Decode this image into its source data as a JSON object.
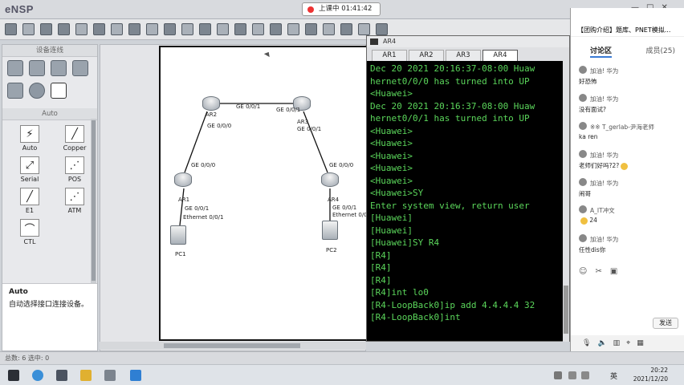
{
  "app": {
    "title": "eNSP",
    "class_status": "上课中 01:41:42"
  },
  "left_panel": {
    "section_title": "设备连线",
    "auto_section_title": "Auto",
    "cables": [
      {
        "label": "Auto",
        "icon": "auto-cable-icon",
        "glyph": "⚡"
      },
      {
        "label": "Copper",
        "icon": "copper-cable-icon",
        "glyph": "╱"
      },
      {
        "label": "Serial",
        "icon": "serial-cable-icon",
        "glyph": "⤢"
      },
      {
        "label": "POS",
        "icon": "pos-cable-icon",
        "glyph": "⋰"
      },
      {
        "label": "E1",
        "icon": "e1-cable-icon",
        "glyph": "╱"
      },
      {
        "label": "ATM",
        "icon": "atm-cable-icon",
        "glyph": "⋰"
      },
      {
        "label": "CTL",
        "icon": "ctl-cable-icon",
        "glyph": "⌒"
      }
    ],
    "desc_title": "Auto",
    "desc_text": "自动选择接口连接设备。"
  },
  "topology": {
    "nodes": {
      "ar1": "AR1",
      "ar2": "AR2",
      "ar3": "AR3",
      "ar4": "AR4",
      "pc1": "PC1",
      "pc2": "PC2"
    },
    "ports": {
      "ar2_ar3_a": "GE 0/0/1",
      "ar2_ar3_b": "GE 0/0/1",
      "ar2_down": "GE 0/0/0",
      "ar3_down": "GE 0/0/1",
      "ar1_up": "GE 0/0/0",
      "ar4_up": "GE 0/0/0",
      "ar1_pc": "GE 0/0/1",
      "pc1_eth": "Ethernet 0/0/1",
      "ar4_pc": "GE 0/0/1",
      "pc2_eth": "Ethernet 0/0/1"
    }
  },
  "terminal": {
    "title": "AR4",
    "tabs": [
      "AR1",
      "AR2",
      "AR3",
      "AR4"
    ],
    "active_tab": "AR4",
    "lines": [
      "Dec 20 2021 20:16:37-08:00 Huaw",
      "hernet0/0/0 has turned into UP",
      "<Huawei>",
      "Dec 20 2021 20:16:37-08:00 Huaw",
      "hernet0/0/1 has turned into UP",
      "<Huawei>",
      "<Huawei>",
      "<Huawei>",
      "<Huawei>",
      "<Huawei>",
      "<Huawei>SY",
      "Enter system view, return user",
      "[Huawei]",
      "[Huawei]",
      "[Huawei]SY R4",
      "[R4]",
      "[R4]",
      "[R4]",
      "[R4]int lo0",
      "[R4-LoopBack0]ip add 4.4.4.4 32",
      "[R4-LoopBack0]int"
    ]
  },
  "chat": {
    "header_tabs": "【团购介绍】题库、PNET模拟...",
    "nav_label": "讨论区",
    "nav_count": "成员(25)",
    "messages": [
      {
        "name": "加油! 华为",
        "text": "好恐怖"
      },
      {
        "name": "加油! 华为",
        "text": "没有面试?"
      },
      {
        "name": "※※ T_gerlab-尹海老师",
        "text": "ka ren"
      },
      {
        "name": "加油! 华为",
        "text": "老师们好吗?2?"
      },
      {
        "name": "加油! 华为",
        "text": "闹哥"
      },
      {
        "name": "A_IT冲文",
        "text": "24"
      },
      {
        "name": "加油! 华为",
        "text": "任性dis你"
      }
    ],
    "send_label": "发送"
  },
  "statusbar": {
    "text": "总数: 6 选中: 0"
  },
  "taskbar": {
    "time": "20:22",
    "date": "2021/12/20",
    "ime": "英"
  }
}
